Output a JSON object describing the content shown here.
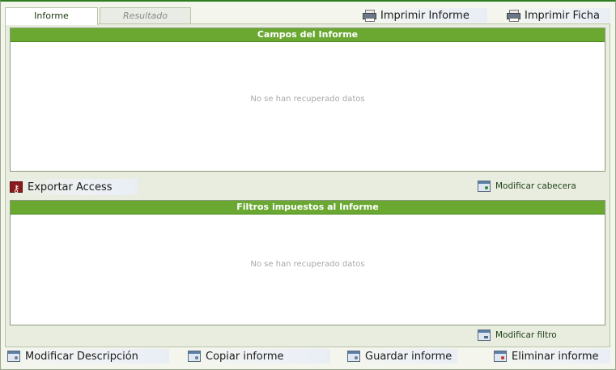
{
  "tabs": {
    "informe": "Informe",
    "resultado": "Resultado"
  },
  "toolbar": {
    "imprimir_informe": "Imprimir Informe",
    "imprimir_ficha": "Imprimir Ficha"
  },
  "campos_panel": {
    "title": "Campos del Informe",
    "empty_text": "No se han recuperado datos"
  },
  "actions_mid": {
    "exportar_access": "Exportar Access",
    "modificar_cabecera": "Modificar cabecera"
  },
  "filtros_panel": {
    "title": "Filtros impuestos al Informe",
    "empty_text": "No se han recuperado datos"
  },
  "filtros_actions": {
    "modificar_filtro": "Modificar filtro"
  },
  "footer": {
    "modificar_descripcion": "Modificar Descripción",
    "copiar_informe": "Copiar informe",
    "guardar_informe": "Guardar informe",
    "eliminar_informe": "Eliminar informe"
  },
  "icons": {
    "print": "printer-icon",
    "access": "access-icon",
    "window": "window-icon",
    "filter": "filter-icon"
  },
  "colors": {
    "header_green": "#6aa832",
    "top_border": "#2f7d1f",
    "access_red": "#8b1a1a"
  }
}
